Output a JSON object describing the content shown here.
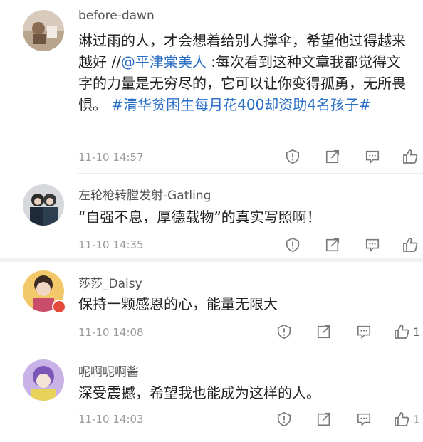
{
  "comments": [
    {
      "username": "before-dawn",
      "text_parts": [
        {
          "t": "淋过雨的人，才会想着给别人撑伞，希望他过得越来越好 //",
          "link": false
        },
        {
          "t": "@平津棠美人",
          "link": true
        },
        {
          "t": " :每次看到这种文章我都觉得文字的力量是无穷尽的，它可以让你变得孤勇，无所畏惧。 ",
          "link": false
        },
        {
          "t": "#清华贫困生每月花400却资助4名孩子#",
          "link": true
        }
      ],
      "time": "11-10 14:57",
      "likes": ""
    },
    {
      "username": "左轮枪转膛发射-Gatling",
      "text_parts": [
        {
          "t": "“自强不息，厚德载物”的真实写照啊！",
          "link": false
        }
      ],
      "time": "11-10 14:35",
      "likes": ""
    },
    {
      "username": "莎莎_Daisy",
      "text_parts": [
        {
          "t": "保持一颗感恩的心，能量无限大",
          "link": false
        }
      ],
      "time": "11-10 14:08",
      "likes": "1"
    },
    {
      "username": "呢啊呢啊酱",
      "text_parts": [
        {
          "t": "深受震撼，希望我也能成为这样的人。",
          "link": false
        }
      ],
      "time": "11-10 14:03",
      "likes": "1"
    }
  ],
  "icons": {
    "report": "report-icon",
    "share": "share-icon",
    "reply": "comment-icon",
    "like": "thumbs-up-icon"
  },
  "colors": {
    "link": "#2a6fc6",
    "text": "#222222",
    "meta": "#9a9a9a"
  }
}
